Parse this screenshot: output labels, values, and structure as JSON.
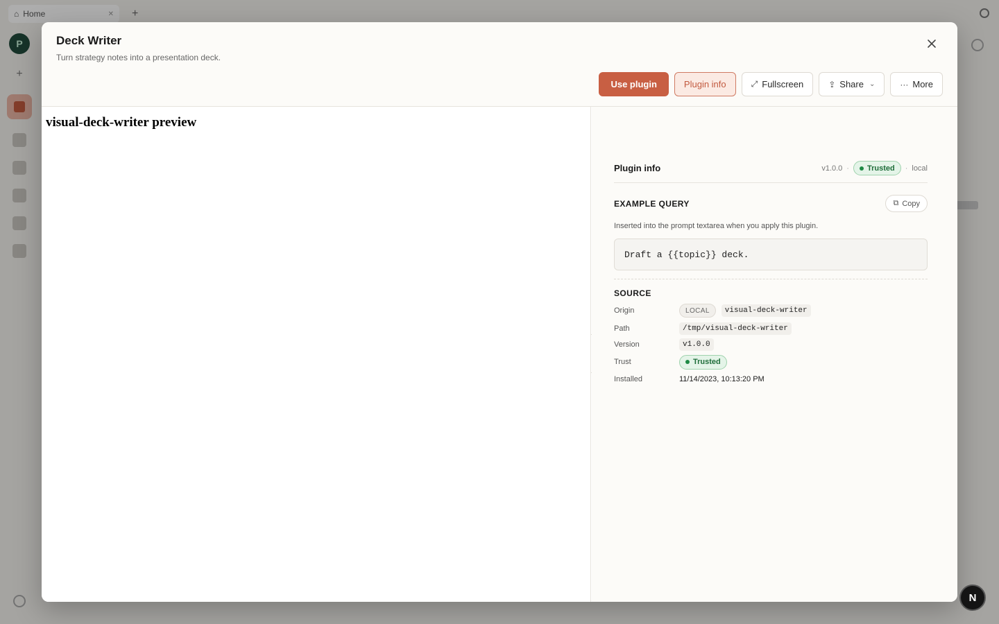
{
  "background": {
    "tab_label": "Home",
    "avatar_glyph": "P"
  },
  "modal": {
    "title": "Deck Writer",
    "subtitle": "Turn strategy notes into a presentation deck.",
    "actions": {
      "use_plugin": "Use plugin",
      "plugin_info": "Plugin info",
      "fullscreen": "Fullscreen",
      "share": "Share",
      "more": "More"
    },
    "preview": {
      "heading": "visual-deck-writer preview"
    },
    "info": {
      "title": "Plugin info",
      "version": "v1.0.0",
      "trust": "Trusted",
      "origin_short": "local",
      "example_query": {
        "title": "EXAMPLE QUERY",
        "copy_label": "Copy",
        "description": "Inserted into the prompt textarea when you apply this plugin.",
        "query": "Draft a {{topic}} deck."
      },
      "source": {
        "title": "SOURCE",
        "origin_label": "Origin",
        "origin_chip": "LOCAL",
        "origin_value": "visual-deck-writer",
        "path_label": "Path",
        "path_value": "/tmp/visual-deck-writer",
        "version_label": "Version",
        "version_value": "v1.0.0",
        "trust_label": "Trust",
        "trust_value": "Trusted",
        "installed_label": "Installed",
        "installed_value": "11/14/2023, 10:13:20 PM"
      }
    }
  },
  "corner_badge": "N",
  "colors": {
    "accent": "#c85f43",
    "trusted_green": "#1f6e3a"
  }
}
